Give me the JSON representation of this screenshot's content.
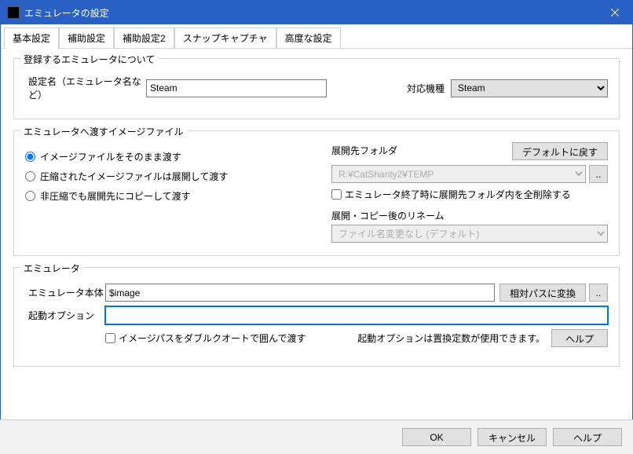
{
  "window": {
    "title": "エミュレータの設定",
    "close_icon": "close-icon"
  },
  "tabs": [
    {
      "label": "基本設定",
      "active": true
    },
    {
      "label": "補助設定",
      "active": false
    },
    {
      "label": "補助設定2",
      "active": false
    },
    {
      "label": "スナップキャプチャ",
      "active": false
    },
    {
      "label": "高度な設定",
      "active": false
    }
  ],
  "section_register": {
    "legend": "登録するエミュレータについて",
    "name_label": "設定名（エミュレータ名など）",
    "name_value": "Steam",
    "machine_label": "対応機種",
    "machine_value": "Steam"
  },
  "section_image": {
    "legend": "エミュレータへ渡すイメージファイル",
    "radio1": "イメージファイルをそのまま渡す",
    "radio2": "圧縮されたイメージファイルは展開して渡す",
    "radio3": "非圧縮でも展開先にコピーして渡す",
    "dest_label": "展開先フォルダ",
    "default_btn": "デフォルトに戻す",
    "dest_value": "R:¥CatShanty2¥TEMP",
    "browse_btn": "..",
    "delete_check": "エミュレータ終了時に展開先フォルダ内を全削除する",
    "rename_label": "展開・コピー後のリネーム",
    "rename_value": "ファイル名変更なし (デフォルト)"
  },
  "section_emu": {
    "legend": "エミュレータ",
    "body_label": "エミュレータ本体",
    "body_value": "$image",
    "relpath_btn": "相対パスに変換",
    "browse_btn": "..",
    "option_label": "起動オプション",
    "option_value": "",
    "quote_check": "イメージパスをダブルクオートで囲んで渡す",
    "hint": "起動オプションは置換定数が使用できます。",
    "help_btn": "ヘルプ"
  },
  "footer": {
    "ok": "OK",
    "cancel": "キャンセル",
    "help": "ヘルプ"
  }
}
